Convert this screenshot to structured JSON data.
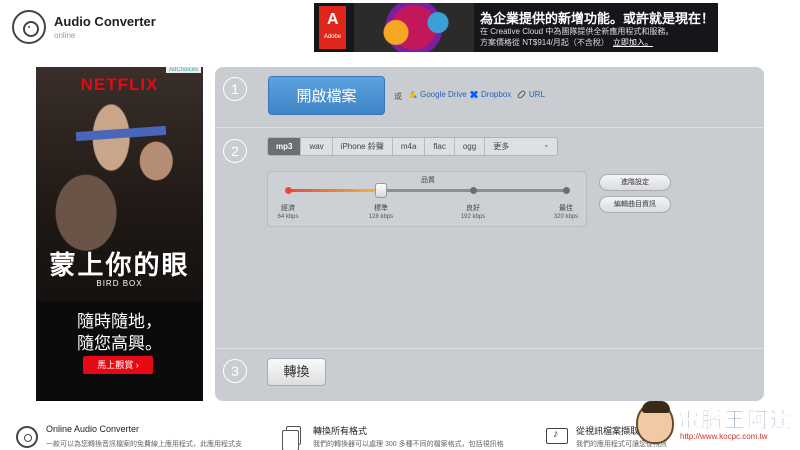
{
  "header": {
    "app_title": "Audio Converter",
    "app_subtitle": "online"
  },
  "top_ad": {
    "brand": "Adobe",
    "headline": "為企業提供的新增功能。或許就是現在！",
    "line2": "在 Creative Cloud 中為團隊提供全新應用程式和服務。",
    "line3": "方案價格從 NT$914/月起（不含稅）",
    "cta": "立即加入。"
  },
  "side_ad": {
    "brand": "NETFLIX",
    "adchoices": "AdChoices",
    "movie_cn": "蒙上你的眼",
    "movie_en": "BIRD BOX",
    "slogan_line1": "隨時隨地，",
    "slogan_line2": "隨您高興。",
    "cta": "馬上觀賞  ›"
  },
  "converter": {
    "steps": [
      "1",
      "2",
      "3"
    ],
    "open_button": "開啟檔案",
    "or_text": "或",
    "sources": [
      {
        "label": "Google Drive",
        "icon": "google-drive-icon"
      },
      {
        "label": "Dropbox",
        "icon": "dropbox-icon"
      },
      {
        "label": "URL",
        "icon": "link-icon"
      }
    ],
    "formats": [
      "mp3",
      "wav",
      "iPhone 鈴聲",
      "m4a",
      "flac",
      "ogg",
      "更多"
    ],
    "active_format": "mp3",
    "quality": {
      "title": "品質",
      "levels": [
        {
          "label": "經濟",
          "rate": "64 kbps"
        },
        {
          "label": "標準",
          "rate": "128 kbps"
        },
        {
          "label": "良好",
          "rate": "192 kbps"
        },
        {
          "label": "最佳",
          "rate": "320 kbps"
        }
      ],
      "selected_index": 1,
      "selected_fraction": 0.333
    },
    "advanced_button": "進階設定",
    "edit_info_button": "編輯曲目資訊",
    "convert_button": "轉換"
  },
  "footer": [
    {
      "title": "Online Audio Converter",
      "desc": "一款可以為您轉換音訊檔案的免費線上應用程式，此應用程式支",
      "icon": "disc-icon"
    },
    {
      "title": "轉換所有格式",
      "desc": "我們的轉換器可以處理 300 多種不同的檔案格式，包括視訊格",
      "icon": "files-icon"
    },
    {
      "title": "從視訊檔案擷取音訊",
      "desc": "我們的應用程式可讓您從視訊",
      "icon": "video-music-icon"
    }
  ],
  "watermark": {
    "text": "電腦王阿達",
    "url": "http://www.kocpc.com.tw"
  },
  "colors": {
    "panel_bg": "#c9ccd1",
    "primary_button": "#4a90d2",
    "netflix_red": "#e50914",
    "link_blue": "#2a63b5"
  }
}
